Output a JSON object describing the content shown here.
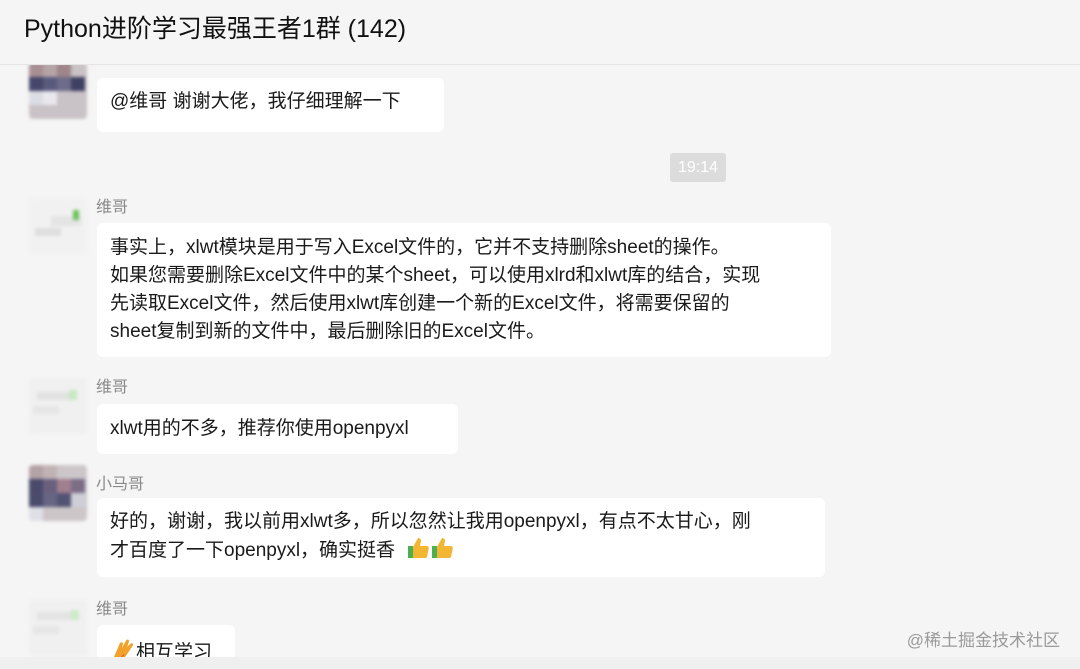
{
  "window": {
    "title": "Python进阶学习最强王者1群 (142)"
  },
  "messages": [
    {
      "sender": "",
      "lines": [
        "@维哥  谢谢大佬，我仔细理解一下"
      ]
    },
    {
      "sender": "维哥",
      "lines": [
        "事实上，xlwt模块是用于写入Excel文件的，它并不支持删除sheet的操作。",
        "如果您需要删除Excel文件中的某个sheet，可以使用xlrd和xlwt库的结合，实现",
        "先读取Excel文件，然后使用xlwt库创建一个新的Excel文件，将需要保留的",
        "sheet复制到新的文件中，最后删除旧的Excel文件。"
      ]
    },
    {
      "sender": "维哥",
      "lines": [
        "xlwt用的不多，推荐你使用openpyxl"
      ]
    },
    {
      "sender": "小马哥",
      "lines": [
        "好的，谢谢，我以前用xlwt多，所以忽然让我用openpyxl，有点不太甘心，刚",
        "才百度了一下openpyxl，确实挺香"
      ]
    },
    {
      "sender": "维哥",
      "lines": [
        "相互学习"
      ]
    }
  ],
  "timestamp": "19:14",
  "watermark": "@稀土掘金技术社区",
  "icons": [
    "thumbs-up-icon",
    "wave-hand-icon"
  ]
}
